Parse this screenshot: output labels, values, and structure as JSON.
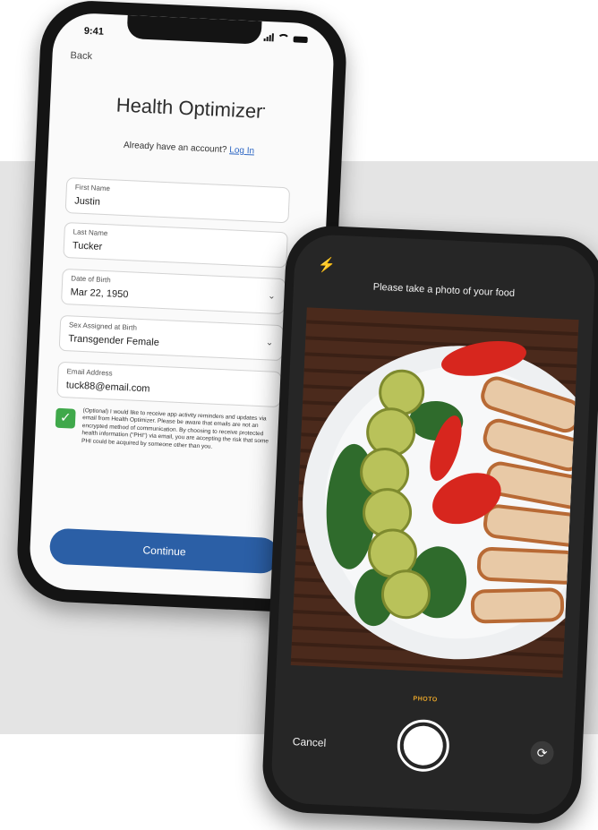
{
  "signup": {
    "status_time": "9:41",
    "back_label": "Back",
    "title": "Health Optimizer",
    "title_mark": "•",
    "login_prompt": "Already have an account?",
    "login_link": "Log In",
    "fields": [
      {
        "label": "First Name",
        "value": "Justin"
      },
      {
        "label": "Last Name",
        "value": "Tucker"
      },
      {
        "label": "Date of Birth",
        "value": "Mar 22, 1950"
      },
      {
        "label": "Sex Assigned at Birth",
        "value": "Transgender Female"
      },
      {
        "label": "Email Address",
        "value": "tuck88@email.com"
      }
    ],
    "consent_checked": true,
    "consent_text": "(Optional) I would like to receive app activity reminders and updates via email from Health Optimizer. Please be aware that emails are not an encrypted method of communication. By choosing to receive protected health information (\"PHI\") via email, you are accepting the risk that some PHI could be acquired by someone other than you.",
    "continue_label": "Continue"
  },
  "camera": {
    "prompt": "Please take a photo of your food",
    "mode_label": "PHOTO",
    "cancel_label": "Cancel"
  },
  "colors": {
    "primary_button": "#2b5fa6",
    "checkbox": "#3fa84a",
    "link": "#2f68c4",
    "photo_mode": "#e6a42a"
  }
}
